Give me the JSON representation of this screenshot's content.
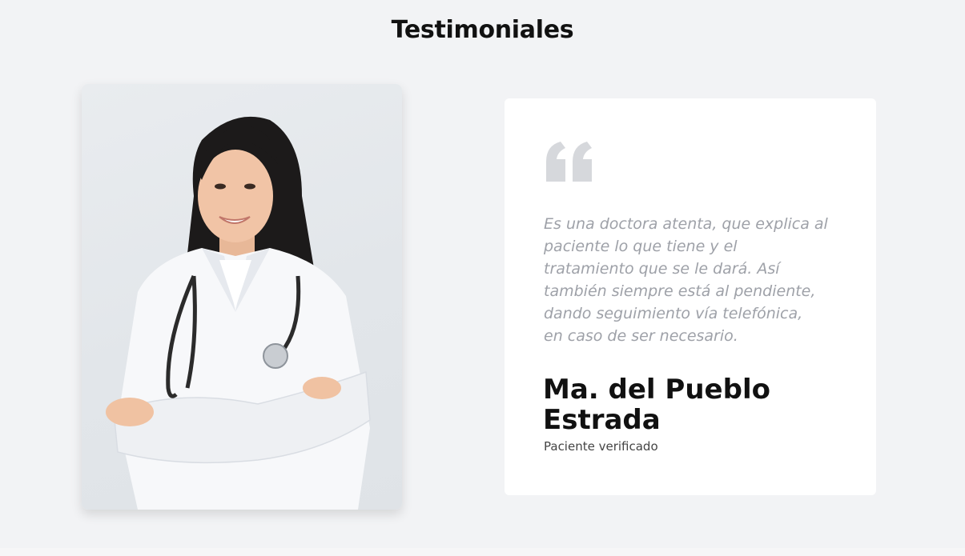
{
  "section": {
    "title": "Testimoniales"
  },
  "testimonial": {
    "photo_alt": "doctor-photo",
    "quote_icon": "quote-icon",
    "quote": "Es una doctora atenta, que explica al\npaciente lo que tiene y el\ntratamiento que se le dará. Así\ntambién siempre está al pendiente,\ndando seguimiento vía telefónica,\nen caso de ser necesario.",
    "author_name": "Ma. del Pueblo Estrada",
    "author_role": "Paciente verificado"
  },
  "colors": {
    "background": "#f2f3f5",
    "card": "#ffffff",
    "quote_icon": "#d6d8dc",
    "quote_text": "#9ea1a8",
    "heading": "#111111"
  }
}
